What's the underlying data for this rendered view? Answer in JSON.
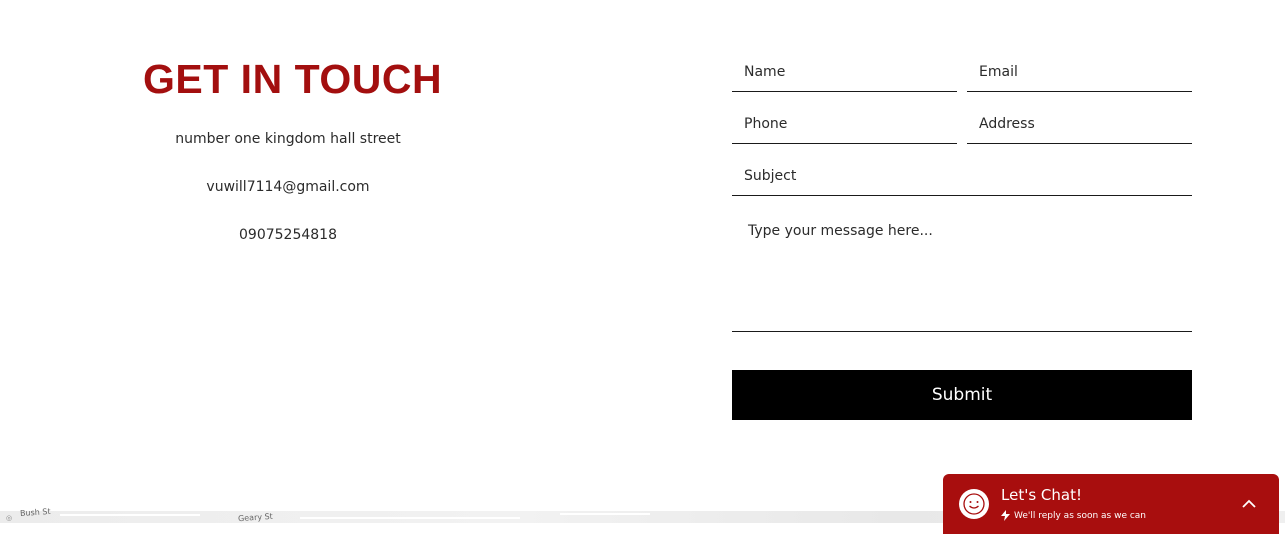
{
  "contact": {
    "heading": "GET IN TOUCH",
    "address": "number one kingdom hall street",
    "email": "vuwill7114@gmail.com",
    "phone": "09075254818"
  },
  "form": {
    "name_placeholder": "Name",
    "email_placeholder": "Email",
    "phone_placeholder": "Phone",
    "address_placeholder": "Address",
    "subject_placeholder": "Subject",
    "message_placeholder": "Type your message here...",
    "submit_label": "Submit"
  },
  "map": {
    "streets": [
      "Bush St",
      "Geary St"
    ]
  },
  "chat": {
    "title": "Let's Chat!",
    "subtitle": "We'll reply as soon as we can",
    "avatar_icon": "smiley-face-icon",
    "subtitle_icon": "lightning-bolt-icon",
    "toggle_icon": "chevron-up-icon",
    "color": "#a80e0e"
  },
  "colors": {
    "heading": "#a30f0f",
    "submit_bg": "#000000"
  }
}
